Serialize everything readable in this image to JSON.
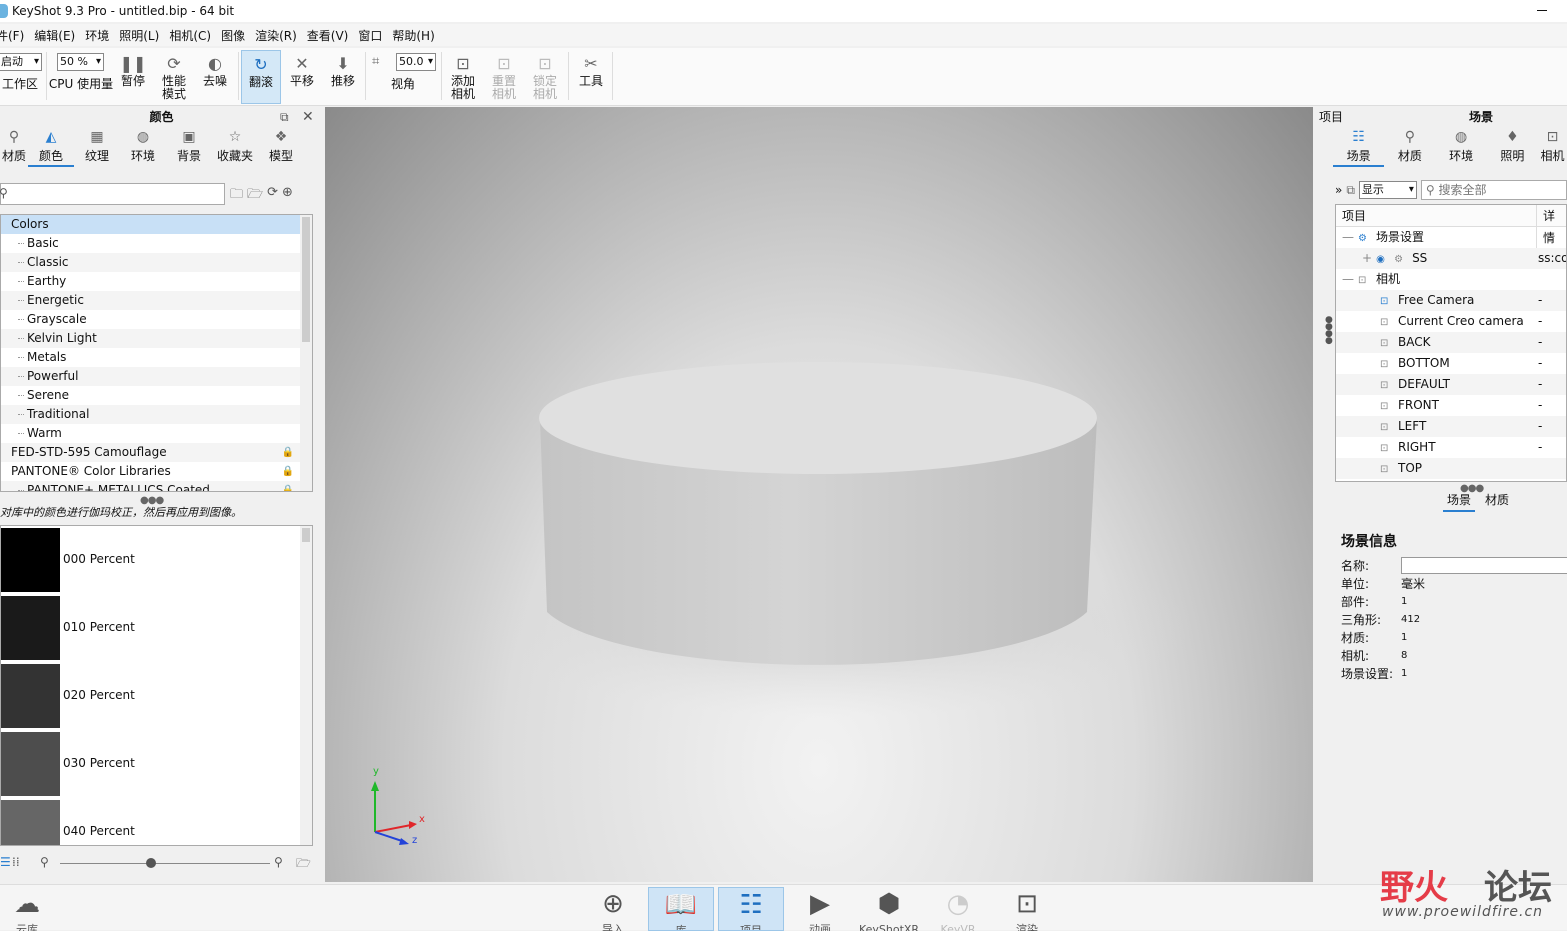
{
  "window": {
    "title": "KeyShot 9.3 Pro  - untitled.bip  - 64 bit"
  },
  "menu": [
    "件(F)",
    "编辑(E)",
    "环境",
    "照明(L)",
    "相机(C)",
    "图像",
    "渲染(R)",
    "查看(V)",
    "窗口",
    "帮助(H)"
  ],
  "toolbar": {
    "workspace_value": "启动",
    "workspace_label": "工作区",
    "cpu_value": "50 %",
    "cpu_label": "CPU 使用量",
    "pause": "暂停",
    "performance_1": "性能",
    "performance_2": "模式",
    "denoise": "去噪",
    "tumble": "翻滚",
    "pan": "平移",
    "dolly": "推移",
    "fov_value": "50.0",
    "fov_label": "视角",
    "add_camera_1": "添加",
    "add_camera_2": "相机",
    "reset_camera_1": "重置",
    "reset_camera_2": "相机",
    "lock_camera_1": "锁定",
    "lock_camera_2": "相机",
    "tools": "工具"
  },
  "left_panel": {
    "title": "颜色",
    "tabs": [
      "材质",
      "颜色",
      "纹理",
      "环境",
      "背景",
      "收藏夹",
      "模型"
    ],
    "active_tab": 1,
    "tree": {
      "root": "Colors",
      "children": [
        "Basic",
        "Classic",
        "Earthy",
        "Energetic",
        "Grayscale",
        "Kelvin Light",
        "Metals",
        "Powerful",
        "Serene",
        "Traditional",
        "Warm"
      ],
      "libraries": [
        "FED-STD-595 Camouflage",
        "PANTONE® Color Libraries",
        "PANTONE+ METALLICS Coated"
      ]
    },
    "hint": "对库中的颜色进行伽玛校正，然后再应用到图像。",
    "swatches": [
      {
        "label": "000 Percent",
        "color": "#000000"
      },
      {
        "label": "010 Percent",
        "color": "#1a1a1a"
      },
      {
        "label": "020 Percent",
        "color": "#333333"
      },
      {
        "label": "030 Percent",
        "color": "#4d4d4d"
      },
      {
        "label": "040 Percent",
        "color": "#666666"
      }
    ]
  },
  "viewport": {
    "axis_x": "x",
    "axis_y": "y",
    "axis_z": "z"
  },
  "right_panel": {
    "title_left": "项目",
    "title": "场景",
    "tabs": [
      "场景",
      "材质",
      "环境",
      "照明",
      "相机"
    ],
    "active_tab": 0,
    "filter": {
      "display": "显示",
      "search_placeholder": "搜索全部"
    },
    "tree_header": {
      "item": "项目",
      "detail": "详情"
    },
    "tree_rows": [
      {
        "label": "场景设置",
        "value": ""
      },
      {
        "label": "SS",
        "value": "ss:co"
      },
      {
        "label": "相机",
        "value": ""
      },
      {
        "label": "Free Camera",
        "value": "-"
      },
      {
        "label": "Current Creo camera",
        "value": "-"
      },
      {
        "label": "BACK",
        "value": "-"
      },
      {
        "label": "BOTTOM",
        "value": "-"
      },
      {
        "label": "DEFAULT",
        "value": "-"
      },
      {
        "label": "FRONT",
        "value": "-"
      },
      {
        "label": "LEFT",
        "value": "-"
      },
      {
        "label": "RIGHT",
        "value": "-"
      },
      {
        "label": "TOP",
        "value": ""
      }
    ],
    "sub_tabs": [
      "场景",
      "材质"
    ],
    "scene_info": {
      "heading": "场景信息",
      "name_label": "名称:",
      "unit_label": "单位:",
      "unit_value": "毫米",
      "parts_label": "部件:",
      "parts_value": "1",
      "triangles_label": "三角形:",
      "triangles_value": "412",
      "materials_label": "材质:",
      "materials_value": "1",
      "cameras_label": "相机:",
      "cameras_value": "8",
      "settings_label": "场景设置:",
      "settings_value": "1"
    }
  },
  "bottom_bar": {
    "cloud": "云库",
    "import": "导入",
    "library": "库",
    "project": "项目",
    "animation": "动画",
    "keyshotxr": "KeyShotXR",
    "keyvr": "KeyVR",
    "render": "渲染"
  },
  "watermark": {
    "brand_1": "野火",
    "brand_2": "论坛",
    "url": "www.proewildfire.cn"
  }
}
